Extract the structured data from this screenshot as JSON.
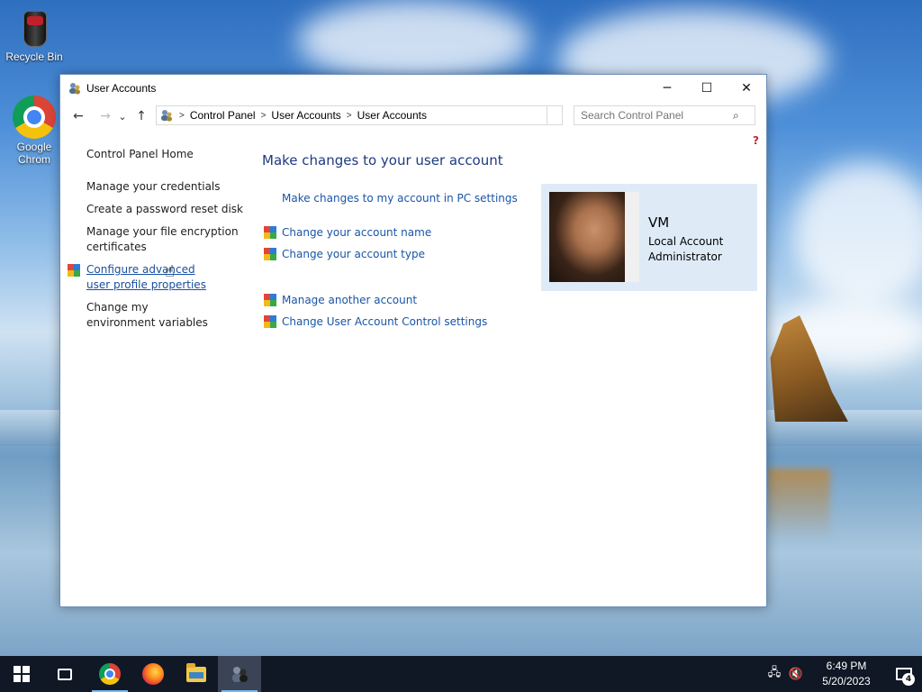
{
  "desktop": {
    "icons": [
      {
        "label": "Recycle Bin",
        "icon": "recycle-bin-icon"
      },
      {
        "label": "Google Chrom",
        "icon": "chrome-icon"
      }
    ]
  },
  "window": {
    "title": "User Accounts",
    "controls": {
      "minimize": "─",
      "maximize": "☐",
      "close": "✕"
    },
    "nav": {
      "back": "←",
      "forward": "→",
      "recent": "⌄",
      "up": "↑"
    },
    "breadcrumb": [
      "Control Panel",
      "User Accounts",
      "User Accounts"
    ],
    "search_placeholder": "Search Control Panel",
    "help": "?"
  },
  "left_pane": {
    "home": "Control Panel Home",
    "links": [
      "Manage your credentials",
      "Create a password reset disk",
      "Manage your file encryption certificates",
      "Configure advanced user profile properties",
      "Change my environment variables"
    ]
  },
  "main": {
    "heading": "Make changes to your user account",
    "pc_settings_link": "Make changes to my account in PC settings",
    "tasks": [
      "Change your account name",
      "Change your account type",
      "Manage another account",
      "Change User Account Control settings"
    ]
  },
  "user": {
    "name": "VM",
    "account_type": "Local Account",
    "role": "Administrator"
  },
  "taskbar": {
    "apps": [
      "start-icon",
      "task-view-icon",
      "chrome-icon",
      "firefox-icon",
      "file-explorer-icon",
      "user-accounts-icon"
    ],
    "time": "6:49 PM",
    "date": "5/20/2023",
    "notification_count": "4"
  },
  "colors": {
    "link": "#1a55a6",
    "heading": "#1e3a80",
    "user_card_bg": "#deebf7",
    "taskbar_bg": "#101826"
  }
}
